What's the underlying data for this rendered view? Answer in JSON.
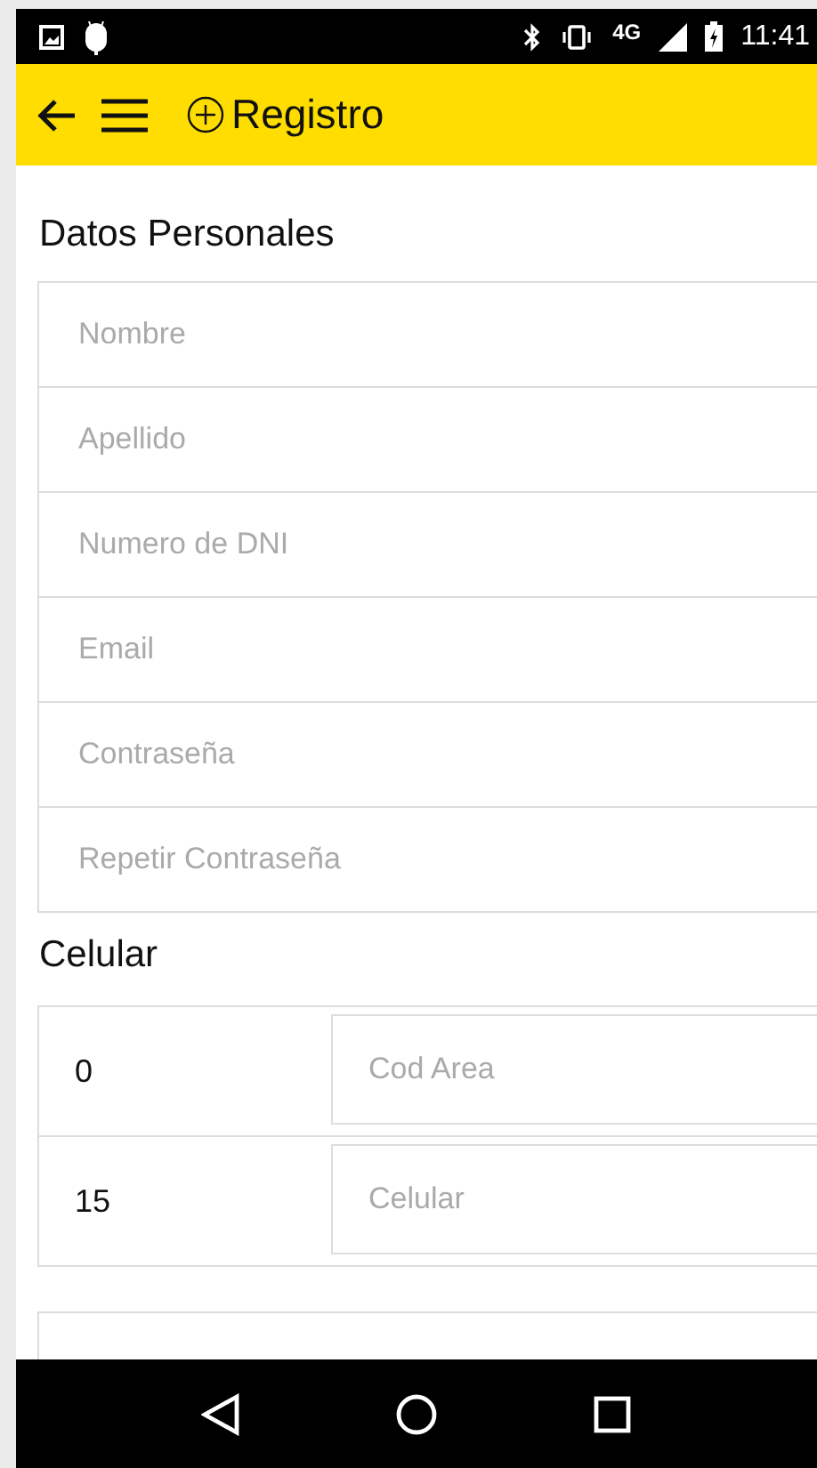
{
  "status_bar": {
    "network": "4G",
    "time": "11:41"
  },
  "app_bar": {
    "title": "Registro"
  },
  "personal": {
    "heading": "Datos Personales",
    "fields": [
      {
        "placeholder": "Nombre"
      },
      {
        "placeholder": "Apellido"
      },
      {
        "placeholder": "Numero de DNI"
      },
      {
        "placeholder": "Email"
      },
      {
        "placeholder": "Contraseña"
      },
      {
        "placeholder": "Repetir Contraseña"
      }
    ]
  },
  "phone": {
    "heading": "Celular",
    "rows": [
      {
        "prefix": "0",
        "placeholder": "Cod Area"
      },
      {
        "prefix": "15",
        "placeholder": "Celular"
      }
    ]
  }
}
